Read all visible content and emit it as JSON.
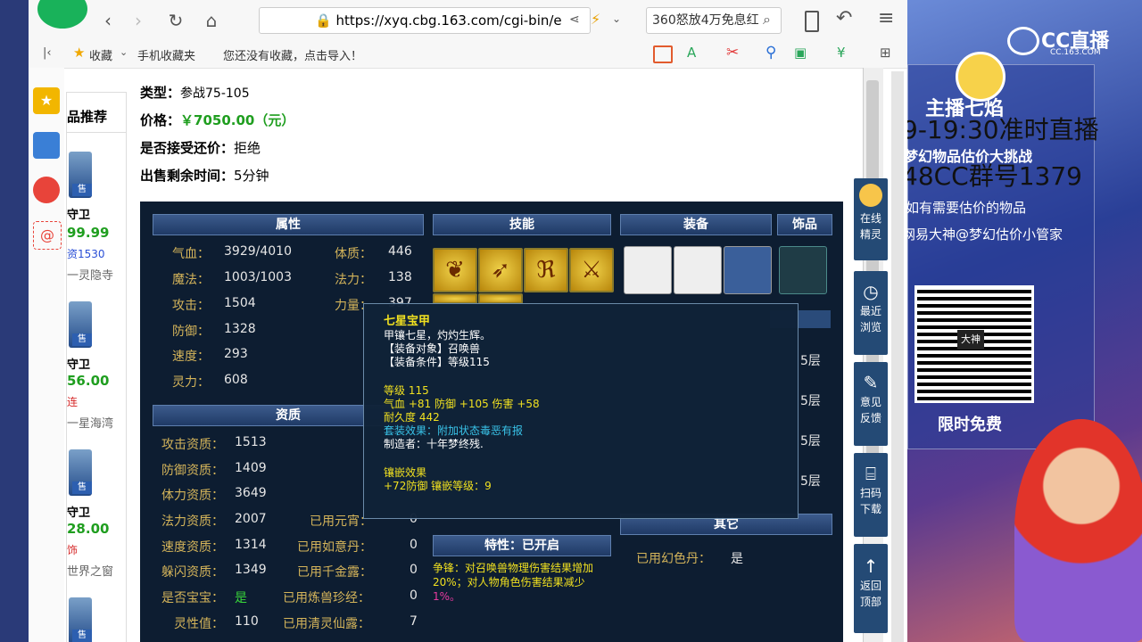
{
  "browser": {
    "url": "https://xyq.cbg.163.com/cgi-bin/e",
    "site_label": "网易",
    "search_text": "360怒放4万免息红",
    "bookmarks": {
      "favorites": "收藏",
      "mobile_favorites": "手机收藏夹",
      "import_hint": "您还没有收藏，点击导入！"
    }
  },
  "sidebar": {
    "title": "品推荐",
    "items": [
      {
        "name": "守卫",
        "price": "99.99",
        "extra": "资1530",
        "server": "一灵隐寺",
        "badge": "售"
      },
      {
        "name": "守卫",
        "price": "56.00",
        "extra": "连",
        "server": "一星海湾",
        "badge": "售"
      },
      {
        "name": "守卫",
        "price": "28.00",
        "extra": "饰",
        "server": "世界之窗",
        "badge": "售"
      },
      {
        "name": "",
        "price": "",
        "extra": "",
        "server": "",
        "badge": "售"
      }
    ]
  },
  "info": {
    "type_label": "类型：",
    "type_value": "参战75-105",
    "price_label": "价格：",
    "price_value": "￥7050.00（元）",
    "bargain_label": "是否接受还价：",
    "bargain_value": "拒绝",
    "remaining_label": "出售剩余时间：",
    "remaining_value": "5分钟"
  },
  "panel": {
    "headers": {
      "attributes": "属性",
      "skills": "技能",
      "equipment": "装备",
      "accessory": "饰品",
      "aptitude": "资质",
      "traits": "特性：已开启",
      "other": "其它"
    },
    "attributes": [
      {
        "label": "气血：",
        "value": "3929/4010"
      },
      {
        "label": "魔法：",
        "value": "1003/1003"
      },
      {
        "label": "攻击：",
        "value": "1504"
      },
      {
        "label": "防御：",
        "value": "1328"
      },
      {
        "label": "速度：",
        "value": "293"
      },
      {
        "label": "灵力：",
        "value": "608"
      }
    ],
    "attributes_right": [
      {
        "label": "体质：",
        "value": "446"
      },
      {
        "label": "法力：",
        "value": "138"
      },
      {
        "label": "力量：",
        "value": "397"
      }
    ],
    "aptitude": [
      {
        "label": "攻击资质：",
        "value": "1513"
      },
      {
        "label": "防御资质：",
        "value": "1409"
      },
      {
        "label": "体力资质：",
        "value": "3649"
      },
      {
        "label": "法力资质：",
        "value": "2007"
      },
      {
        "label": "速度资质：",
        "value": "1314"
      },
      {
        "label": "躲闪资质：",
        "value": "1349"
      },
      {
        "label": "是否宝宝：",
        "value": "是"
      },
      {
        "label": "灵性值：",
        "value": "110"
      }
    ],
    "aptitude_right": [
      {
        "label": "已用元宵：",
        "value": "0"
      },
      {
        "label": "已用如意丹：",
        "value": "0"
      },
      {
        "label": "已用千金露：",
        "value": "0"
      },
      {
        "label": "已用炼兽珍经：",
        "value": "0"
      },
      {
        "label": "已用清灵仙露：",
        "value": "7"
      }
    ],
    "layers": [
      "5层",
      "5层",
      "5层",
      "5层"
    ],
    "trait_text_1": "争锋：对召唤兽物理伤害结果增加",
    "trait_text_2": "20%；对人物角色伤害结果减少",
    "trait_text_3": "1%。",
    "other_label": "已用幻色丹：",
    "other_value": "是",
    "tooltip": {
      "title": "七星宝甲",
      "desc": "甲镶七星，灼灼生辉。",
      "target": "【装备对象】召唤兽",
      "requirement": "【装备条件】等级115",
      "level": "等级 115",
      "stats": "气血 +81 防御 +105 伤害 +58",
      "durability": "耐久度 442",
      "set_effect": "套装效果：附加状态毒恶有报",
      "maker": "制造者：十年梦终残.",
      "inlay_title": "镶嵌效果",
      "inlay_detail": "+72防御 镶嵌等级：9"
    }
  },
  "tools": [
    {
      "label1": "在线",
      "label2": "精灵"
    },
    {
      "label1": "最近",
      "label2": "浏览"
    },
    {
      "label1": "意见",
      "label2": "反馈"
    },
    {
      "label1": "扫码",
      "label2": "下载"
    },
    {
      "label1": "返回",
      "label2": "顶部"
    }
  ],
  "stream": {
    "logo": "CC直播",
    "logo_sub": "CC.163.COM",
    "streamer": "主播七焰",
    "schedule": "9-19:30准时直播",
    "event": "梦幻物品估价大挑战",
    "group": "48CC群号1379",
    "hint": "如有需要估价的物品",
    "contact": "网易大神@梦幻估价小管家",
    "qr_label": "大神",
    "free": "限时免费"
  },
  "colors": {
    "price_green": "#1f9e1f",
    "panel_bg": "#0d1d31",
    "tooltip_yellow": "#f0e020",
    "tooltip_cyan": "#39c3e8"
  }
}
